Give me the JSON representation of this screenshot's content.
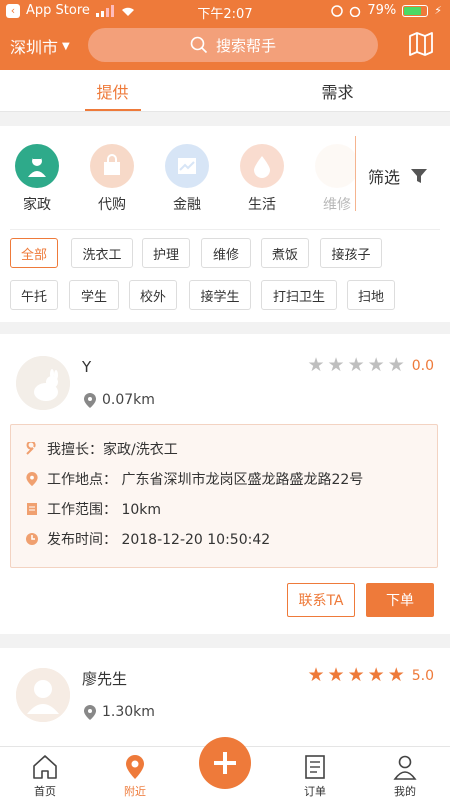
{
  "status": {
    "back_label": "App Store",
    "time": "下午2:07",
    "battery": "79%"
  },
  "header": {
    "city": "深圳市",
    "search_placeholder": "搜索帮手"
  },
  "tabs": [
    {
      "label": "提供",
      "active": true
    },
    {
      "label": "需求",
      "active": false
    }
  ],
  "categories": [
    {
      "label": "家政",
      "icon": "housekeeping-icon",
      "color": "#2eaa8a"
    },
    {
      "label": "代购",
      "icon": "shopping-icon",
      "color": "#f7d9c8"
    },
    {
      "label": "金融",
      "icon": "finance-icon",
      "color": "#d7e5f6"
    },
    {
      "label": "生活",
      "icon": "life-icon",
      "color": "#f9dccf"
    },
    {
      "label": "维修",
      "icon": "repair-icon",
      "color": "#faeee5"
    }
  ],
  "filter_label": "筛选",
  "tags": [
    {
      "label": "全部",
      "active": true
    },
    {
      "label": "洗衣工",
      "active": false
    },
    {
      "label": "护理",
      "active": false
    },
    {
      "label": "维修",
      "active": false
    },
    {
      "label": "煮饭",
      "active": false
    },
    {
      "label": "接孩子",
      "active": false
    },
    {
      "label": "午托",
      "active": false
    },
    {
      "label": "学生",
      "active": false
    },
    {
      "label": "校外",
      "active": false
    },
    {
      "label": "接学生",
      "active": false
    },
    {
      "label": "打扫卫生",
      "active": false
    },
    {
      "label": "扫地",
      "active": false
    }
  ],
  "cards": [
    {
      "name": "Y",
      "distance": "0.07km",
      "rating": "0.0",
      "stars_filled": 0,
      "skill": "我擅长：家政/洗衣工",
      "location": "工作地点：  广东省深圳市龙岗区盛龙路盛龙路22号",
      "range": "工作范围：  10km",
      "time": "发布时间：  2018-12-20 10:50:42",
      "contact_label": "联系TA",
      "order_label": "下单"
    },
    {
      "name": "廖先生",
      "distance": "1.30km",
      "rating": "5.0",
      "stars_filled": 5
    }
  ],
  "bottom_nav": [
    {
      "label": "首页",
      "icon": "home-icon",
      "active": false
    },
    {
      "label": "附近",
      "icon": "location-icon",
      "active": true
    },
    {
      "label": "",
      "icon": "plus-icon",
      "active": false
    },
    {
      "label": "订单",
      "icon": "order-icon",
      "active": false
    },
    {
      "label": "我的",
      "icon": "user-icon",
      "active": false
    }
  ],
  "colors": {
    "accent": "#ee7a3a",
    "star_empty": "#bfbfbf"
  }
}
